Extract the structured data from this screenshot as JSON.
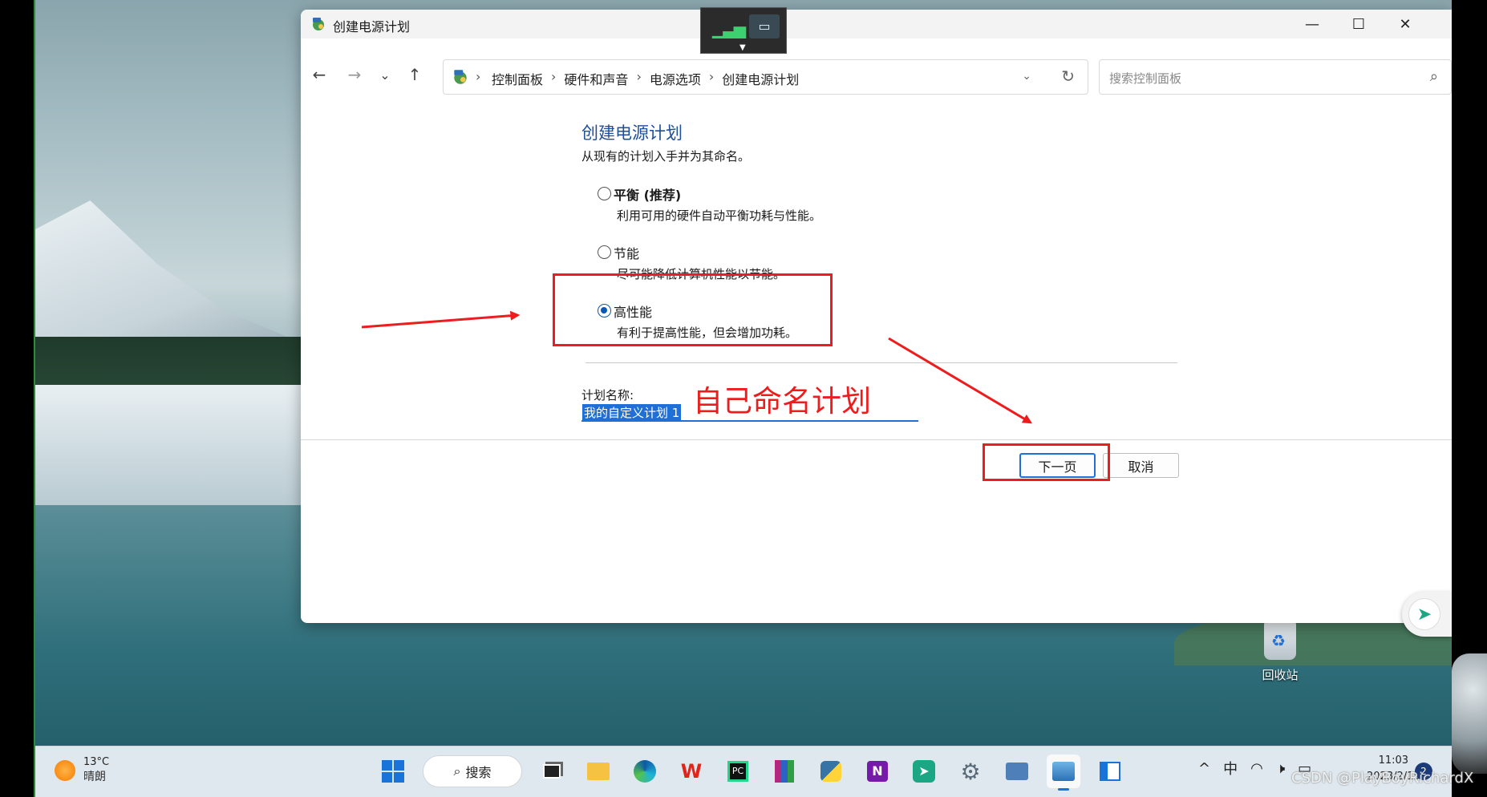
{
  "window": {
    "title": "创建电源计划",
    "controls": {
      "minimize": "—",
      "maximize": "☐",
      "close": "✕"
    }
  },
  "nav": {
    "back": "←",
    "forward": "→",
    "recent": "⌄",
    "up": "↑",
    "breadcrumbs": [
      "控制面板",
      "硬件和声音",
      "电源选项",
      "创建电源计划"
    ],
    "separator": "›",
    "search_placeholder": "搜索控制面板"
  },
  "content": {
    "heading": "创建电源计划",
    "subtitle": "从现有的计划入手并为其命名。",
    "options": [
      {
        "label": "平衡 (推荐)",
        "desc": "利用可用的硬件自动平衡功耗与性能。",
        "selected": false
      },
      {
        "label": "节能",
        "desc": "尽可能降低计算机性能以节能。",
        "selected": false
      },
      {
        "label": "高性能",
        "desc": "有利于提高性能，但会增加功耗。",
        "selected": true
      }
    ],
    "plan_name_label": "计划名称:",
    "plan_name_value": "我的自定义计划 1",
    "next_button": "下一页",
    "cancel_button": "取消"
  },
  "annotation": {
    "text": "自己命名计划",
    "color": "#ee1c1c"
  },
  "desktop": {
    "recycle_bin_label": "回收站"
  },
  "taskbar": {
    "weather_temp": "13°C",
    "weather_desc": "晴朗",
    "search_label": "搜索",
    "ime": "中",
    "time": "11:03",
    "date": "2023/2/15",
    "notification_count": "2"
  },
  "watermark": "CSDN @PlayBoyRichardX",
  "colors": {
    "accent": "#1f6fd6",
    "heading": "#1f4e9c",
    "annotation": "#ee1c1c"
  }
}
